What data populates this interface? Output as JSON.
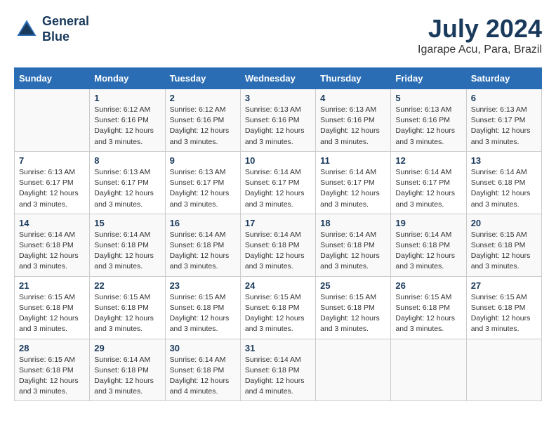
{
  "logo": {
    "line1": "General",
    "line2": "Blue"
  },
  "title": "July 2024",
  "location": "Igarape Acu, Para, Brazil",
  "weekdays": [
    "Sunday",
    "Monday",
    "Tuesday",
    "Wednesday",
    "Thursday",
    "Friday",
    "Saturday"
  ],
  "weeks": [
    [
      {
        "day": "",
        "info": ""
      },
      {
        "day": "1",
        "info": "Sunrise: 6:12 AM\nSunset: 6:16 PM\nDaylight: 12 hours\nand 3 minutes."
      },
      {
        "day": "2",
        "info": "Sunrise: 6:12 AM\nSunset: 6:16 PM\nDaylight: 12 hours\nand 3 minutes."
      },
      {
        "day": "3",
        "info": "Sunrise: 6:13 AM\nSunset: 6:16 PM\nDaylight: 12 hours\nand 3 minutes."
      },
      {
        "day": "4",
        "info": "Sunrise: 6:13 AM\nSunset: 6:16 PM\nDaylight: 12 hours\nand 3 minutes."
      },
      {
        "day": "5",
        "info": "Sunrise: 6:13 AM\nSunset: 6:16 PM\nDaylight: 12 hours\nand 3 minutes."
      },
      {
        "day": "6",
        "info": "Sunrise: 6:13 AM\nSunset: 6:17 PM\nDaylight: 12 hours\nand 3 minutes."
      }
    ],
    [
      {
        "day": "7",
        "info": "Sunrise: 6:13 AM\nSunset: 6:17 PM\nDaylight: 12 hours\nand 3 minutes."
      },
      {
        "day": "8",
        "info": "Sunrise: 6:13 AM\nSunset: 6:17 PM\nDaylight: 12 hours\nand 3 minutes."
      },
      {
        "day": "9",
        "info": "Sunrise: 6:13 AM\nSunset: 6:17 PM\nDaylight: 12 hours\nand 3 minutes."
      },
      {
        "day": "10",
        "info": "Sunrise: 6:14 AM\nSunset: 6:17 PM\nDaylight: 12 hours\nand 3 minutes."
      },
      {
        "day": "11",
        "info": "Sunrise: 6:14 AM\nSunset: 6:17 PM\nDaylight: 12 hours\nand 3 minutes."
      },
      {
        "day": "12",
        "info": "Sunrise: 6:14 AM\nSunset: 6:17 PM\nDaylight: 12 hours\nand 3 minutes."
      },
      {
        "day": "13",
        "info": "Sunrise: 6:14 AM\nSunset: 6:18 PM\nDaylight: 12 hours\nand 3 minutes."
      }
    ],
    [
      {
        "day": "14",
        "info": "Sunrise: 6:14 AM\nSunset: 6:18 PM\nDaylight: 12 hours\nand 3 minutes."
      },
      {
        "day": "15",
        "info": "Sunrise: 6:14 AM\nSunset: 6:18 PM\nDaylight: 12 hours\nand 3 minutes."
      },
      {
        "day": "16",
        "info": "Sunrise: 6:14 AM\nSunset: 6:18 PM\nDaylight: 12 hours\nand 3 minutes."
      },
      {
        "day": "17",
        "info": "Sunrise: 6:14 AM\nSunset: 6:18 PM\nDaylight: 12 hours\nand 3 minutes."
      },
      {
        "day": "18",
        "info": "Sunrise: 6:14 AM\nSunset: 6:18 PM\nDaylight: 12 hours\nand 3 minutes."
      },
      {
        "day": "19",
        "info": "Sunrise: 6:14 AM\nSunset: 6:18 PM\nDaylight: 12 hours\nand 3 minutes."
      },
      {
        "day": "20",
        "info": "Sunrise: 6:15 AM\nSunset: 6:18 PM\nDaylight: 12 hours\nand 3 minutes."
      }
    ],
    [
      {
        "day": "21",
        "info": "Sunrise: 6:15 AM\nSunset: 6:18 PM\nDaylight: 12 hours\nand 3 minutes."
      },
      {
        "day": "22",
        "info": "Sunrise: 6:15 AM\nSunset: 6:18 PM\nDaylight: 12 hours\nand 3 minutes."
      },
      {
        "day": "23",
        "info": "Sunrise: 6:15 AM\nSunset: 6:18 PM\nDaylight: 12 hours\nand 3 minutes."
      },
      {
        "day": "24",
        "info": "Sunrise: 6:15 AM\nSunset: 6:18 PM\nDaylight: 12 hours\nand 3 minutes."
      },
      {
        "day": "25",
        "info": "Sunrise: 6:15 AM\nSunset: 6:18 PM\nDaylight: 12 hours\nand 3 minutes."
      },
      {
        "day": "26",
        "info": "Sunrise: 6:15 AM\nSunset: 6:18 PM\nDaylight: 12 hours\nand 3 minutes."
      },
      {
        "day": "27",
        "info": "Sunrise: 6:15 AM\nSunset: 6:18 PM\nDaylight: 12 hours\nand 3 minutes."
      }
    ],
    [
      {
        "day": "28",
        "info": "Sunrise: 6:15 AM\nSunset: 6:18 PM\nDaylight: 12 hours\nand 3 minutes."
      },
      {
        "day": "29",
        "info": "Sunrise: 6:14 AM\nSunset: 6:18 PM\nDaylight: 12 hours\nand 3 minutes."
      },
      {
        "day": "30",
        "info": "Sunrise: 6:14 AM\nSunset: 6:18 PM\nDaylight: 12 hours\nand 4 minutes."
      },
      {
        "day": "31",
        "info": "Sunrise: 6:14 AM\nSunset: 6:18 PM\nDaylight: 12 hours\nand 4 minutes."
      },
      {
        "day": "",
        "info": ""
      },
      {
        "day": "",
        "info": ""
      },
      {
        "day": "",
        "info": ""
      }
    ]
  ]
}
